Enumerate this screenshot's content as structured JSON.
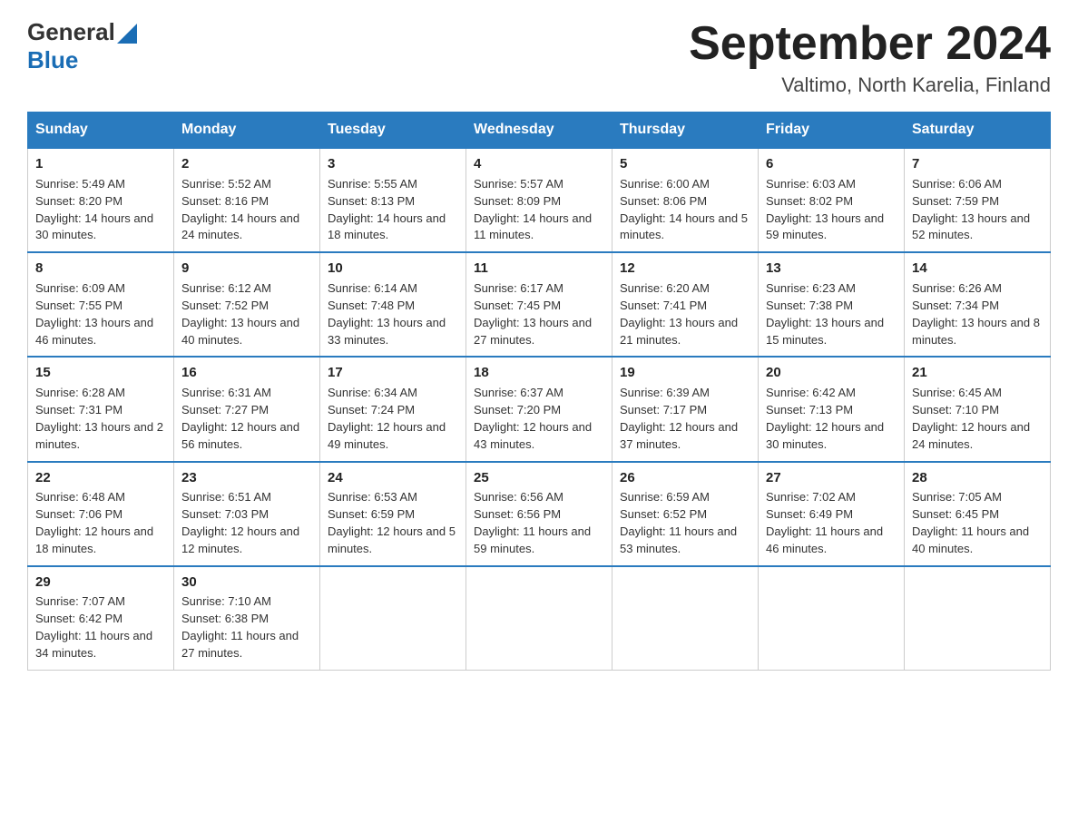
{
  "logo": {
    "general": "General",
    "blue": "Blue"
  },
  "title": "September 2024",
  "subtitle": "Valtimo, North Karelia, Finland",
  "weekdays": [
    "Sunday",
    "Monday",
    "Tuesday",
    "Wednesday",
    "Thursday",
    "Friday",
    "Saturday"
  ],
  "weeks": [
    [
      {
        "day": "1",
        "sunrise": "5:49 AM",
        "sunset": "8:20 PM",
        "daylight": "14 hours and 30 minutes."
      },
      {
        "day": "2",
        "sunrise": "5:52 AM",
        "sunset": "8:16 PM",
        "daylight": "14 hours and 24 minutes."
      },
      {
        "day": "3",
        "sunrise": "5:55 AM",
        "sunset": "8:13 PM",
        "daylight": "14 hours and 18 minutes."
      },
      {
        "day": "4",
        "sunrise": "5:57 AM",
        "sunset": "8:09 PM",
        "daylight": "14 hours and 11 minutes."
      },
      {
        "day": "5",
        "sunrise": "6:00 AM",
        "sunset": "8:06 PM",
        "daylight": "14 hours and 5 minutes."
      },
      {
        "day": "6",
        "sunrise": "6:03 AM",
        "sunset": "8:02 PM",
        "daylight": "13 hours and 59 minutes."
      },
      {
        "day": "7",
        "sunrise": "6:06 AM",
        "sunset": "7:59 PM",
        "daylight": "13 hours and 52 minutes."
      }
    ],
    [
      {
        "day": "8",
        "sunrise": "6:09 AM",
        "sunset": "7:55 PM",
        "daylight": "13 hours and 46 minutes."
      },
      {
        "day": "9",
        "sunrise": "6:12 AM",
        "sunset": "7:52 PM",
        "daylight": "13 hours and 40 minutes."
      },
      {
        "day": "10",
        "sunrise": "6:14 AM",
        "sunset": "7:48 PM",
        "daylight": "13 hours and 33 minutes."
      },
      {
        "day": "11",
        "sunrise": "6:17 AM",
        "sunset": "7:45 PM",
        "daylight": "13 hours and 27 minutes."
      },
      {
        "day": "12",
        "sunrise": "6:20 AM",
        "sunset": "7:41 PM",
        "daylight": "13 hours and 21 minutes."
      },
      {
        "day": "13",
        "sunrise": "6:23 AM",
        "sunset": "7:38 PM",
        "daylight": "13 hours and 15 minutes."
      },
      {
        "day": "14",
        "sunrise": "6:26 AM",
        "sunset": "7:34 PM",
        "daylight": "13 hours and 8 minutes."
      }
    ],
    [
      {
        "day": "15",
        "sunrise": "6:28 AM",
        "sunset": "7:31 PM",
        "daylight": "13 hours and 2 minutes."
      },
      {
        "day": "16",
        "sunrise": "6:31 AM",
        "sunset": "7:27 PM",
        "daylight": "12 hours and 56 minutes."
      },
      {
        "day": "17",
        "sunrise": "6:34 AM",
        "sunset": "7:24 PM",
        "daylight": "12 hours and 49 minutes."
      },
      {
        "day": "18",
        "sunrise": "6:37 AM",
        "sunset": "7:20 PM",
        "daylight": "12 hours and 43 minutes."
      },
      {
        "day": "19",
        "sunrise": "6:39 AM",
        "sunset": "7:17 PM",
        "daylight": "12 hours and 37 minutes."
      },
      {
        "day": "20",
        "sunrise": "6:42 AM",
        "sunset": "7:13 PM",
        "daylight": "12 hours and 30 minutes."
      },
      {
        "day": "21",
        "sunrise": "6:45 AM",
        "sunset": "7:10 PM",
        "daylight": "12 hours and 24 minutes."
      }
    ],
    [
      {
        "day": "22",
        "sunrise": "6:48 AM",
        "sunset": "7:06 PM",
        "daylight": "12 hours and 18 minutes."
      },
      {
        "day": "23",
        "sunrise": "6:51 AM",
        "sunset": "7:03 PM",
        "daylight": "12 hours and 12 minutes."
      },
      {
        "day": "24",
        "sunrise": "6:53 AM",
        "sunset": "6:59 PM",
        "daylight": "12 hours and 5 minutes."
      },
      {
        "day": "25",
        "sunrise": "6:56 AM",
        "sunset": "6:56 PM",
        "daylight": "11 hours and 59 minutes."
      },
      {
        "day": "26",
        "sunrise": "6:59 AM",
        "sunset": "6:52 PM",
        "daylight": "11 hours and 53 minutes."
      },
      {
        "day": "27",
        "sunrise": "7:02 AM",
        "sunset": "6:49 PM",
        "daylight": "11 hours and 46 minutes."
      },
      {
        "day": "28",
        "sunrise": "7:05 AM",
        "sunset": "6:45 PM",
        "daylight": "11 hours and 40 minutes."
      }
    ],
    [
      {
        "day": "29",
        "sunrise": "7:07 AM",
        "sunset": "6:42 PM",
        "daylight": "11 hours and 34 minutes."
      },
      {
        "day": "30",
        "sunrise": "7:10 AM",
        "sunset": "6:38 PM",
        "daylight": "11 hours and 27 minutes."
      },
      null,
      null,
      null,
      null,
      null
    ]
  ]
}
